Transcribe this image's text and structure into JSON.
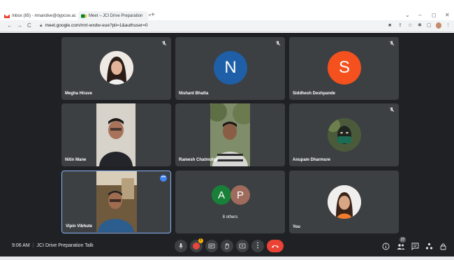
{
  "browser": {
    "tabs": [
      {
        "title": "Inbox (85) - mnandive@dypcoe.ac",
        "close": "×"
      },
      {
        "title": "Meet – JCI Drive Preparation",
        "close": "×"
      }
    ],
    "new_tab": "+",
    "window_controls": {
      "collapse": "⌄",
      "minimize": "–",
      "maximize": "◻",
      "close": "✕"
    },
    "url": "meet.google.com/mrt-wxdw-eue?pli=1&authuser=0",
    "nav": {
      "back": "←",
      "forward": "→",
      "reload": "C"
    }
  },
  "participants": [
    {
      "name": "Megha Hirave",
      "muted": true,
      "kind": "photo"
    },
    {
      "name": "Nishant Bhatta",
      "muted": true,
      "kind": "initial",
      "initial": "N",
      "color": "#1e5fa8"
    },
    {
      "name": "Siddhesh Deshpande",
      "muted": true,
      "kind": "initial",
      "initial": "S",
      "color": "#f4511e"
    },
    {
      "name": "Nitin Mane",
      "muted": false,
      "kind": "video"
    },
    {
      "name": "Ramesh Chatmutge",
      "muted": false,
      "kind": "video"
    },
    {
      "name": "Anupam Dharmure",
      "muted": true,
      "kind": "photo"
    },
    {
      "name": "Vipin Vibhute",
      "muted": false,
      "kind": "video"
    },
    {
      "name": "8 others",
      "muted": false,
      "kind": "group",
      "initials": [
        "A",
        "P"
      ],
      "colors": [
        "#188038",
        "#9e6b5c"
      ]
    },
    {
      "name": "You",
      "muted": false,
      "kind": "photo"
    }
  ],
  "meeting": {
    "time": "9:06 AM",
    "separator": "|",
    "title": "JCI Drive Preparation Talk",
    "participant_count": "17",
    "badge": "!"
  },
  "colors": {
    "background": "#202124",
    "tile": "#3c4043",
    "hangup": "#ea4335",
    "active_border": "#8ab4f8"
  }
}
